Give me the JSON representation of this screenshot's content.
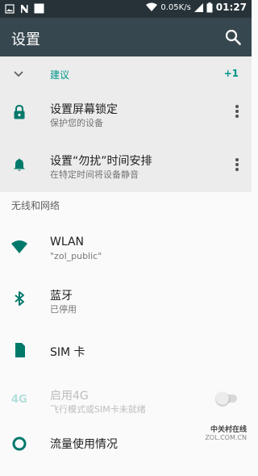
{
  "status_bar": {
    "network_speed": "0.05K/s",
    "time": "01:27"
  },
  "app_bar": {
    "title": "设置"
  },
  "suggestions": {
    "title": "建议",
    "count": "+1",
    "items": [
      {
        "title": "设置屏幕锁定",
        "subtitle": "保护您的设备",
        "icon": "lock-icon"
      },
      {
        "title": "设置“勿扰”时间安排",
        "subtitle": "在特定时间将设备静音",
        "icon": "bell-icon"
      }
    ]
  },
  "section": {
    "header": "无线和网络",
    "items": [
      {
        "title": "WLAN",
        "subtitle": "\"zol_public\"",
        "icon": "wifi-icon"
      },
      {
        "title": "蓝牙",
        "subtitle": "已停用",
        "icon": "bluetooth-icon"
      },
      {
        "title": "SIM 卡",
        "subtitle": "",
        "icon": "sim-card-icon"
      },
      {
        "title": "启用4G",
        "subtitle": "飞行模式或SIM卡未就绪",
        "icon": "4g-icon",
        "badge": "4G",
        "disabled": true,
        "toggle_on": false
      },
      {
        "title": "流量使用情况",
        "subtitle": "",
        "icon": "data-usage-icon"
      }
    ]
  },
  "watermark": {
    "brand": "中关村在线",
    "url": "ZOL.COM.CN"
  },
  "colors": {
    "status_bar": "#263238",
    "app_bar": "#37474f",
    "accent": "#009688",
    "icon": "#00796b"
  }
}
